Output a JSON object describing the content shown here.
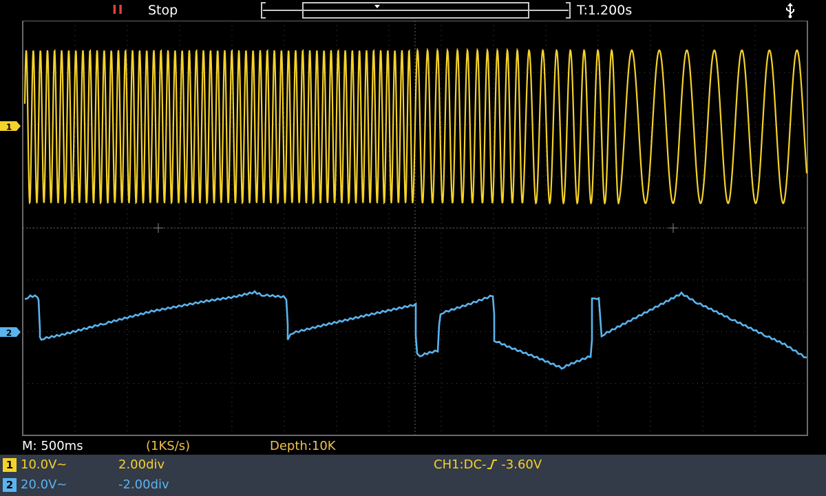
{
  "status": {
    "run_state": "Stop",
    "trigger_position": "T:1.200s"
  },
  "acquisition": {
    "timebase": "M: 500ms",
    "sample_rate": "(1KS/s)",
    "depth": "Depth:10K"
  },
  "channels": [
    {
      "number": "1",
      "scale": "10.0V~",
      "offset": "2.00div",
      "color": "#f5d22a"
    },
    {
      "number": "2",
      "scale": "20.0V~",
      "offset": "-2.00div",
      "color": "#5ab4ee"
    }
  ],
  "trigger": {
    "source_coupling": "CH1:DC-",
    "level": "-3.60V"
  },
  "colors": {
    "ch1": "#f5d22a",
    "ch2": "#5ab4ee",
    "stop_icon": "#e8413c",
    "grid": "#5a5a5a",
    "panel": "#333a48"
  },
  "icons": [
    "pause-icon",
    "usb-icon",
    "ch1-marker-icon",
    "ch2-marker-icon",
    "rising-edge-icon"
  ]
}
